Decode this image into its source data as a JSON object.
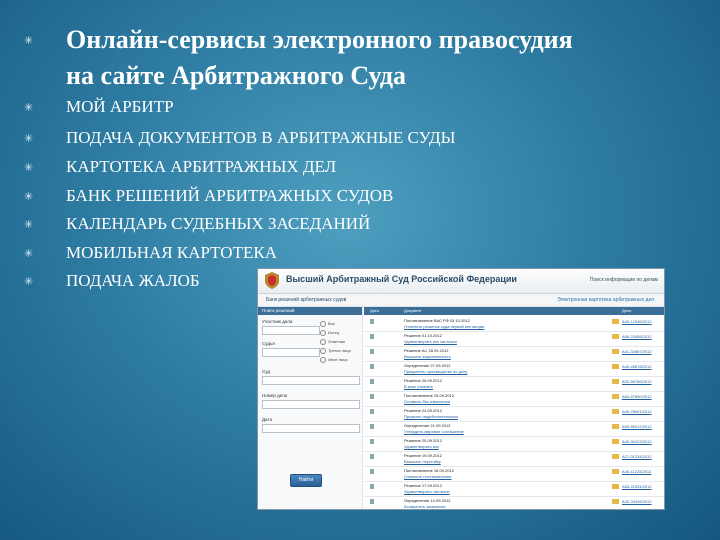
{
  "slide": {
    "title_line1": "Онлайн-сервисы электронного правосудия",
    "title_line2": "на сайте Арбитражного Суда",
    "bullet_glyph": "✳",
    "items": [
      "МОЙ АРБИТР",
      "ПОДАЧА ДОКУМЕНТОВ В АРБИТРАЖНЫЕ СУДЫ",
      "КАРТОТЕКА АРБИТРАЖНЫХ ДЕЛ",
      "БАНК РЕШЕНИЙ АРБИТРАЖНЫХ СУДОВ",
      "КАЛЕНДАРЬ СУДЕБНЫХ ЗАСЕДАНИЙ",
      "МОБИЛЬНАЯ КАРТОТЕКА",
      "ПОДАЧА ЖАЛОБ"
    ]
  },
  "screenshot": {
    "court_name": "Высший Арбитражный Суд Российской Федерации",
    "header_link": "Поиск информации по делам",
    "toolbar_left": "Банк решений арбитражных судов",
    "toolbar_right": "Электронная картотека арбитражных дел",
    "sidebar_title": "Поиск решений",
    "fields": {
      "participant": "Участник дела",
      "judge": "Судья",
      "court": "Суд",
      "case_number": "Номер дела",
      "period": "Дата",
      "find_button": "Найти"
    },
    "radio_options": [
      "Все",
      "Истец",
      "Ответчик",
      "Третье лицо",
      "Иное лицо"
    ],
    "table_headers": [
      "Дата",
      "Документ",
      "Дело"
    ],
    "rows": [
      {
        "line1": "Постановление ВАС РФ 03.10.2012",
        "line2": "Отменить решение суда первой инстанции",
        "case": "А40-12345/2012"
      },
      {
        "line1": "Решение 01.10.2012",
        "line2": "Удовлетворить иск частично",
        "case": "А56-23456/2012"
      },
      {
        "line1": "Решение АС 28.09.2012",
        "line2": "Взыскать задолженность",
        "case": "А41-34567/2012"
      },
      {
        "line1": "Определение 27.09.2012",
        "line2": "Прекратить производство по делу",
        "case": "А40-45678/2012"
      },
      {
        "line1": "Решение 26.09.2012",
        "line2": "В иске отказать",
        "case": "А32-56789/2012"
      },
      {
        "line1": "Постановление 25.09.2012",
        "line2": "Оставить без изменения",
        "case": "А60-67890/2012"
      },
      {
        "line1": "Решение 24.09.2012",
        "line2": "Признать недействительным",
        "case": "А40-78901/2012"
      },
      {
        "line1": "Определение 21.09.2012",
        "line2": "Утвердить мировое соглашение",
        "case": "А55-89012/2012"
      },
      {
        "line1": "Решение 20.09.2012",
        "line2": "Удовлетворить иск",
        "case": "А40-90123/2012"
      },
      {
        "line1": "Решение 19.09.2012",
        "line2": "Взыскать неустойку",
        "case": "А27-01234/2012"
      },
      {
        "line1": "Постановление 18.09.2012",
        "line2": "Отменить постановление",
        "case": "А40-11223/2012"
      },
      {
        "line1": "Решение 17.09.2012",
        "line2": "Удовлетворить частично",
        "case": "А65-22334/2012"
      },
      {
        "line1": "Определение 14.09.2012",
        "line2": "Возвратить заявление",
        "case": "А40-33445/2012"
      }
    ]
  }
}
